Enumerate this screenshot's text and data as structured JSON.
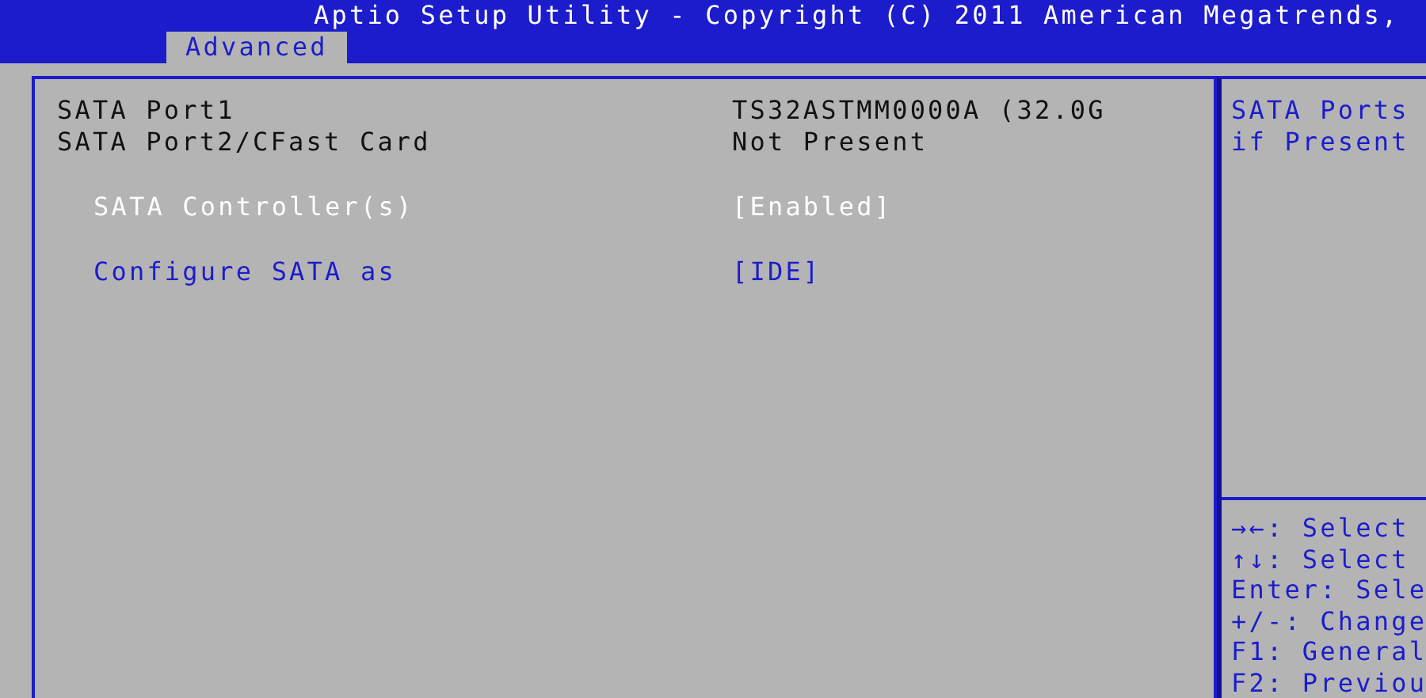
{
  "header": {
    "title": "Aptio Setup Utility - Copyright (C) 2011 American Megatrends,"
  },
  "tabs": [
    {
      "label": "Advanced",
      "selected": true
    }
  ],
  "settings": [
    {
      "kind": "info",
      "label": "SATA Port1",
      "value": "TS32ASTMM0000A (32.0G"
    },
    {
      "kind": "info",
      "label": "SATA Port2/CFast Card",
      "value": "Not Present"
    },
    {
      "kind": "option",
      "label": "SATA Controller(s)",
      "value": "[Enabled]",
      "selected": true
    },
    {
      "kind": "option",
      "label": "Configure SATA as",
      "value": "[IDE]",
      "selected": false
    }
  ],
  "help": {
    "description": [
      "SATA Ports",
      "if Present"
    ],
    "keys": [
      "→←: Select",
      "↑↓: Select",
      "Enter: Sele",
      "+/-: Change",
      "F1: General",
      "F2: Previou"
    ]
  }
}
